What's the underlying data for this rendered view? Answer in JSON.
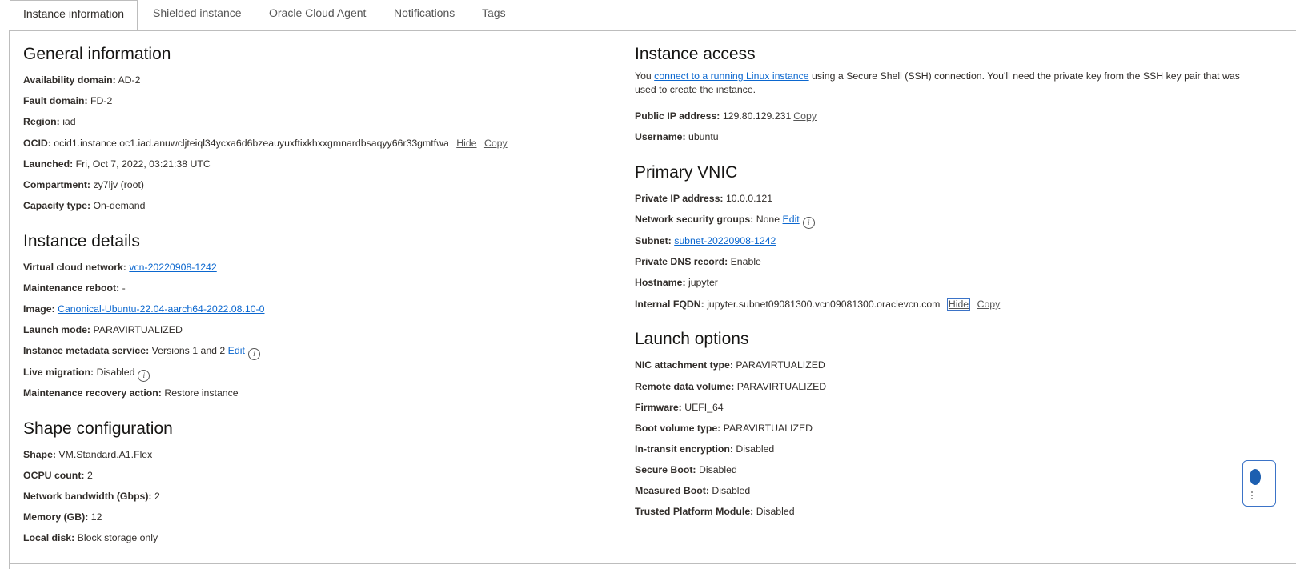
{
  "tabs": [
    "Instance information",
    "Shielded instance",
    "Oracle Cloud Agent",
    "Notifications",
    "Tags"
  ],
  "general": {
    "title": "General information",
    "availability_domain": {
      "label": "Availability domain:",
      "value": "AD-2"
    },
    "fault_domain": {
      "label": "Fault domain:",
      "value": "FD-2"
    },
    "region": {
      "label": "Region:",
      "value": "iad"
    },
    "ocid": {
      "label": "OCID:",
      "value": "ocid1.instance.oc1.iad.anuwcljteiql34ycxa6d6bzeauyuxftixkhxxgmnardbsaqyy66r33gmtfwa",
      "hide": "Hide",
      "copy": "Copy"
    },
    "launched": {
      "label": "Launched:",
      "value": "Fri, Oct 7, 2022, 03:21:38 UTC"
    },
    "compartment": {
      "label": "Compartment:",
      "value": "zy7ljv (root)"
    },
    "capacity_type": {
      "label": "Capacity type:",
      "value": "On-demand"
    }
  },
  "details": {
    "title": "Instance details",
    "vcn": {
      "label": "Virtual cloud network:",
      "value": "vcn-20220908-1242"
    },
    "maintenance_reboot": {
      "label": "Maintenance reboot:",
      "value": "-"
    },
    "image": {
      "label": "Image:",
      "value": "Canonical-Ubuntu-22.04-aarch64-2022.08.10-0"
    },
    "launch_mode": {
      "label": "Launch mode:",
      "value": "PARAVIRTUALIZED"
    },
    "metadata_service": {
      "label": "Instance metadata service:",
      "value": "Versions 1 and 2",
      "edit": "Edit"
    },
    "live_migration": {
      "label": "Live migration:",
      "value": "Disabled"
    },
    "recovery_action": {
      "label": "Maintenance recovery action:",
      "value": "Restore instance"
    }
  },
  "shape": {
    "title": "Shape configuration",
    "shape": {
      "label": "Shape:",
      "value": "VM.Standard.A1.Flex"
    },
    "ocpu": {
      "label": "OCPU count:",
      "value": "2"
    },
    "bandwidth": {
      "label": "Network bandwidth (Gbps):",
      "value": "2"
    },
    "memory": {
      "label": "Memory (GB):",
      "value": "12"
    },
    "local_disk": {
      "label": "Local disk:",
      "value": "Block storage only"
    }
  },
  "access": {
    "title": "Instance access",
    "text_before": "You ",
    "link": "connect to a running Linux instance",
    "text_after": " using a Secure Shell (SSH) connection. You'll need the private key from the SSH key pair that was used to create the instance.",
    "public_ip": {
      "label": "Public IP address:",
      "value": "129.80.129.231",
      "copy": "Copy"
    },
    "username": {
      "label": "Username:",
      "value": "ubuntu"
    }
  },
  "vnic": {
    "title": "Primary VNIC",
    "private_ip": {
      "label": "Private IP address:",
      "value": "10.0.0.121"
    },
    "nsg": {
      "label": "Network security groups:",
      "value": "None",
      "edit": "Edit"
    },
    "subnet": {
      "label": "Subnet:",
      "value": "subnet-20220908-1242"
    },
    "dns": {
      "label": "Private DNS record:",
      "value": "Enable"
    },
    "hostname": {
      "label": "Hostname:",
      "value": "jupyter"
    },
    "fqdn": {
      "label": "Internal FQDN:",
      "value": "jupyter.subnet09081300.vcn09081300.oraclevcn.com",
      "hide": "Hide",
      "copy": "Copy"
    }
  },
  "launch": {
    "title": "Launch options",
    "nic": {
      "label": "NIC attachment type:",
      "value": "PARAVIRTUALIZED"
    },
    "remote": {
      "label": "Remote data volume:",
      "value": "PARAVIRTUALIZED"
    },
    "firmware": {
      "label": "Firmware:",
      "value": "UEFI_64"
    },
    "boot": {
      "label": "Boot volume type:",
      "value": "PARAVIRTUALIZED"
    },
    "transit": {
      "label": "In-transit encryption:",
      "value": "Disabled"
    },
    "secure_boot": {
      "label": "Secure Boot:",
      "value": "Disabled"
    },
    "measured_boot": {
      "label": "Measured Boot:",
      "value": "Disabled"
    },
    "tpm": {
      "label": "Trusted Platform Module:",
      "value": "Disabled"
    }
  }
}
